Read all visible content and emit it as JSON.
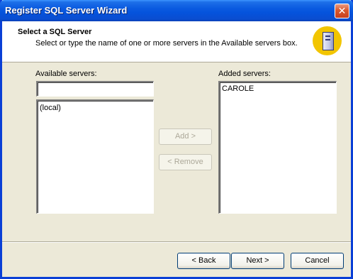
{
  "window": {
    "title": "Register SQL Server Wizard",
    "close": "✕"
  },
  "header": {
    "title": "Select a SQL Server",
    "subtitle": "Select or type the name of one or more servers in the Available servers box."
  },
  "available": {
    "label": "Available servers:",
    "input_value": "",
    "items": [
      "(local)"
    ]
  },
  "added": {
    "label": "Added servers:",
    "items": [
      "CAROLE"
    ]
  },
  "buttons": {
    "add": "Add >",
    "remove": "< Remove",
    "back": "< Back",
    "next": "Next >",
    "cancel": "Cancel"
  }
}
